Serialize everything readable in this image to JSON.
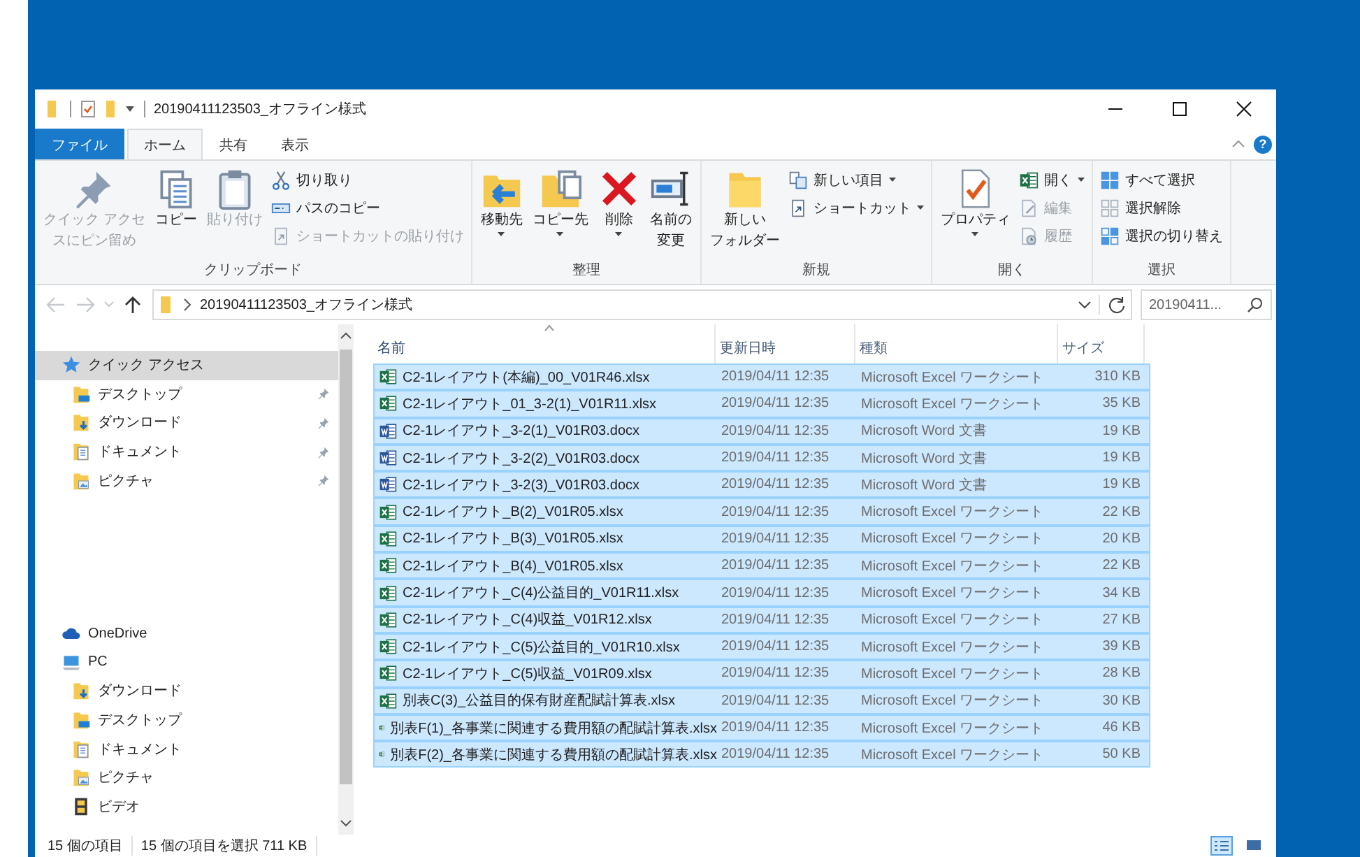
{
  "window": {
    "title": "20190411123503_オフライン様式"
  },
  "ribbon_tabs": [
    {
      "label": "ファイル",
      "kind": "file",
      "selected": false
    },
    {
      "label": "ホーム",
      "kind": "tab",
      "selected": true
    },
    {
      "label": "共有",
      "kind": "tab",
      "selected": false
    },
    {
      "label": "表示",
      "kind": "tab",
      "selected": false
    }
  ],
  "help_button": "?",
  "ribbon_groups": [
    {
      "label": "クリップボード",
      "items": [
        {
          "lines": [
            "クイック アクセ",
            "スにピン留め"
          ],
          "kind": "large",
          "disabled": true,
          "dropdown": false
        },
        {
          "lines": [
            "コピー"
          ],
          "kind": "large",
          "disabled": false,
          "dropdown": false
        },
        {
          "lines": [
            "貼り付け"
          ],
          "kind": "large",
          "disabled": true,
          "dropdown": false
        },
        {
          "label": "切り取り",
          "kind": "small",
          "disabled": false,
          "dropdown": false
        },
        {
          "label": "パスのコピー",
          "kind": "small",
          "disabled": false,
          "dropdown": false
        },
        {
          "label": "ショートカットの貼り付け",
          "kind": "small",
          "disabled": true,
          "dropdown": false
        }
      ]
    },
    {
      "label": "整理",
      "items": [
        {
          "lines": [
            "移動先"
          ],
          "kind": "large",
          "disabled": false,
          "dropdown": true
        },
        {
          "lines": [
            "コピー先"
          ],
          "kind": "large",
          "disabled": false,
          "dropdown": true
        },
        {
          "lines": [
            "削除"
          ],
          "kind": "large",
          "disabled": false,
          "dropdown": true
        },
        {
          "lines": [
            "名前の",
            "変更"
          ],
          "kind": "large",
          "disabled": false,
          "dropdown": false
        }
      ]
    },
    {
      "label": "新規",
      "items": [
        {
          "lines": [
            "新しい",
            "フォルダー"
          ],
          "kind": "large",
          "disabled": false,
          "dropdown": false
        },
        {
          "label": "新しい項目",
          "kind": "small",
          "disabled": false,
          "dropdown": true
        },
        {
          "label": "ショートカット",
          "kind": "small",
          "disabled": false,
          "dropdown": true
        }
      ]
    },
    {
      "label": "開く",
      "items": [
        {
          "lines": [
            "プロパティ"
          ],
          "kind": "large",
          "disabled": false,
          "dropdown": true
        },
        {
          "label": "開く",
          "kind": "small",
          "disabled": false,
          "dropdown": true
        },
        {
          "label": "編集",
          "kind": "small",
          "disabled": true,
          "dropdown": false
        },
        {
          "label": "履歴",
          "kind": "small",
          "disabled": true,
          "dropdown": false
        }
      ]
    },
    {
      "label": "選択",
      "items": [
        {
          "label": "すべて選択",
          "kind": "small",
          "disabled": false,
          "dropdown": false
        },
        {
          "label": "選択解除",
          "kind": "small",
          "disabled": false,
          "dropdown": false
        },
        {
          "label": "選択の切り替え",
          "kind": "small",
          "disabled": false,
          "dropdown": false
        }
      ]
    }
  ],
  "nav_buttons": [
    {
      "kind": "back",
      "disabled": true
    },
    {
      "kind": "forward",
      "disabled": true
    },
    {
      "kind": "recent",
      "disabled": true
    },
    {
      "kind": "up",
      "disabled": false
    }
  ],
  "address": {
    "path": "20190411123503_オフライン様式"
  },
  "search": {
    "placeholder": "20190411..."
  },
  "sidebar": {
    "groups": [
      [
        {
          "label": "クイック アクセス",
          "kind": "star",
          "selected": true,
          "children": [
            {
              "label": "デスクトップ",
              "kind": "desktop",
              "pinned": true,
              "selected": false
            },
            {
              "label": "ダウンロード",
              "kind": "download",
              "pinned": true,
              "selected": false
            },
            {
              "label": "ドキュメント",
              "kind": "documents",
              "pinned": true,
              "selected": false
            },
            {
              "label": "ピクチャ",
              "kind": "pictures",
              "pinned": true,
              "selected": false
            }
          ]
        }
      ],
      [
        {
          "label": "OneDrive",
          "kind": "cloud",
          "selected": false
        },
        {
          "label": "PC",
          "kind": "pc",
          "selected": false,
          "children": [
            {
              "label": "ダウンロード",
              "kind": "download",
              "pinned": false,
              "selected": false
            },
            {
              "label": "デスクトップ",
              "kind": "desktop",
              "pinned": false,
              "selected": false
            },
            {
              "label": "ドキュメント",
              "kind": "documents",
              "pinned": false,
              "selected": false
            },
            {
              "label": "ピクチャ",
              "kind": "pictures",
              "pinned": false,
              "selected": false
            },
            {
              "label": "ビデオ",
              "kind": "videos",
              "pinned": false,
              "selected": false
            }
          ]
        }
      ]
    ]
  },
  "table": {
    "columns": [
      {
        "label": "名前",
        "sorted": true
      },
      {
        "label": "更新日時",
        "sorted": false
      },
      {
        "label": "種類",
        "sorted": false
      },
      {
        "label": "サイズ",
        "sorted": false
      }
    ],
    "rows": [
      {
        "name": "C2-1レイアウト(本編)_00_V01R46.xlsx",
        "date": "2019/04/11 12:35",
        "type": "Microsoft Excel ワークシート",
        "size": "310 KB",
        "kind": "excel",
        "selected": true
      },
      {
        "name": "C2-1レイアウト_01_3-2(1)_V01R11.xlsx",
        "date": "2019/04/11 12:35",
        "type": "Microsoft Excel ワークシート",
        "size": "35 KB",
        "kind": "excel",
        "selected": true
      },
      {
        "name": "C2-1レイアウト_3-2(1)_V01R03.docx",
        "date": "2019/04/11 12:35",
        "type": "Microsoft Word 文書",
        "size": "19 KB",
        "kind": "word",
        "selected": true
      },
      {
        "name": "C2-1レイアウト_3-2(2)_V01R03.docx",
        "date": "2019/04/11 12:35",
        "type": "Microsoft Word 文書",
        "size": "19 KB",
        "kind": "word",
        "selected": true
      },
      {
        "name": "C2-1レイアウト_3-2(3)_V01R03.docx",
        "date": "2019/04/11 12:35",
        "type": "Microsoft Word 文書",
        "size": "19 KB",
        "kind": "word",
        "selected": true
      },
      {
        "name": "C2-1レイアウト_B(2)_V01R05.xlsx",
        "date": "2019/04/11 12:35",
        "type": "Microsoft Excel ワークシート",
        "size": "22 KB",
        "kind": "excel",
        "selected": true
      },
      {
        "name": "C2-1レイアウト_B(3)_V01R05.xlsx",
        "date": "2019/04/11 12:35",
        "type": "Microsoft Excel ワークシート",
        "size": "20 KB",
        "kind": "excel",
        "selected": true
      },
      {
        "name": "C2-1レイアウト_B(4)_V01R05.xlsx",
        "date": "2019/04/11 12:35",
        "type": "Microsoft Excel ワークシート",
        "size": "22 KB",
        "kind": "excel",
        "selected": true
      },
      {
        "name": "C2-1レイアウト_C(4)公益目的_V01R11.xlsx",
        "date": "2019/04/11 12:35",
        "type": "Microsoft Excel ワークシート",
        "size": "34 KB",
        "kind": "excel",
        "selected": true
      },
      {
        "name": "C2-1レイアウト_C(4)収益_V01R12.xlsx",
        "date": "2019/04/11 12:35",
        "type": "Microsoft Excel ワークシート",
        "size": "27 KB",
        "kind": "excel",
        "selected": true
      },
      {
        "name": "C2-1レイアウト_C(5)公益目的_V01R10.xlsx",
        "date": "2019/04/11 12:35",
        "type": "Microsoft Excel ワークシート",
        "size": "39 KB",
        "kind": "excel",
        "selected": true
      },
      {
        "name": "C2-1レイアウト_C(5)収益_V01R09.xlsx",
        "date": "2019/04/11 12:35",
        "type": "Microsoft Excel ワークシート",
        "size": "28 KB",
        "kind": "excel",
        "selected": true
      },
      {
        "name": "別表C(3)_公益目的保有財産配賦計算表.xlsx",
        "date": "2019/04/11 12:35",
        "type": "Microsoft Excel ワークシート",
        "size": "30 KB",
        "kind": "excel",
        "selected": true
      },
      {
        "name": "別表F(1)_各事業に関連する費用額の配賦計算表.xlsx",
        "date": "2019/04/11 12:35",
        "type": "Microsoft Excel ワークシート",
        "size": "46 KB",
        "kind": "excel",
        "selected": true
      },
      {
        "name": "別表F(2)_各事業に関連する費用額の配賦計算表.xlsx",
        "date": "2019/04/11 12:35",
        "type": "Microsoft Excel ワークシート",
        "size": "50 KB",
        "kind": "excel",
        "selected": true
      }
    ]
  },
  "status_bar": {
    "item_count": "15 個の項目",
    "selection": "15 個の項目を選択  711 KB"
  },
  "view_buttons": [
    {
      "kind": "details",
      "selected": true
    },
    {
      "kind": "large_icons",
      "selected": false
    }
  ]
}
